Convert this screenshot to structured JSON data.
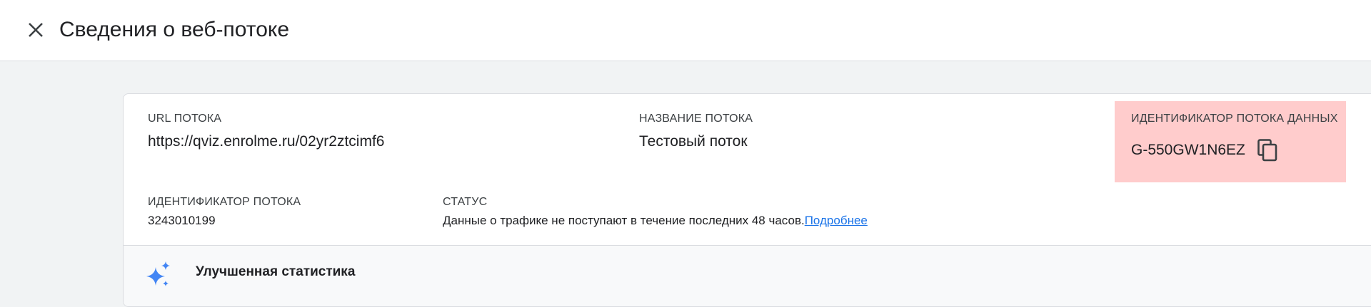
{
  "header": {
    "title": "Сведения о веб-потоке",
    "close_icon": "close-icon"
  },
  "details": {
    "stream_url": {
      "label": "URL ПОТОКА",
      "value": "https://qviz.enrolme.ru/02yr2ztcimf6"
    },
    "stream_name": {
      "label": "НАЗВАНИЕ ПОТОКА",
      "value": "Тестовый поток"
    },
    "measurement_id": {
      "label": "ИДЕНТИФИКАТОР ПОТОКА ДАННЫХ",
      "value": "G-550GW1N6EZ",
      "copy_icon": "copy-icon",
      "highlight_color": "#ffcccc"
    },
    "stream_id": {
      "label": "ИДЕНТИФИКАТОР ПОТОКА",
      "value": "3243010199"
    },
    "status": {
      "label": "СТАТУС",
      "text": "Данные о трафике не поступают в течение последних 48 часов.",
      "link": "Подробнее",
      "link_color": "#1a73e8"
    }
  },
  "enhanced": {
    "icon": "sparkle-icon",
    "label": "Улучшенная статистика"
  }
}
